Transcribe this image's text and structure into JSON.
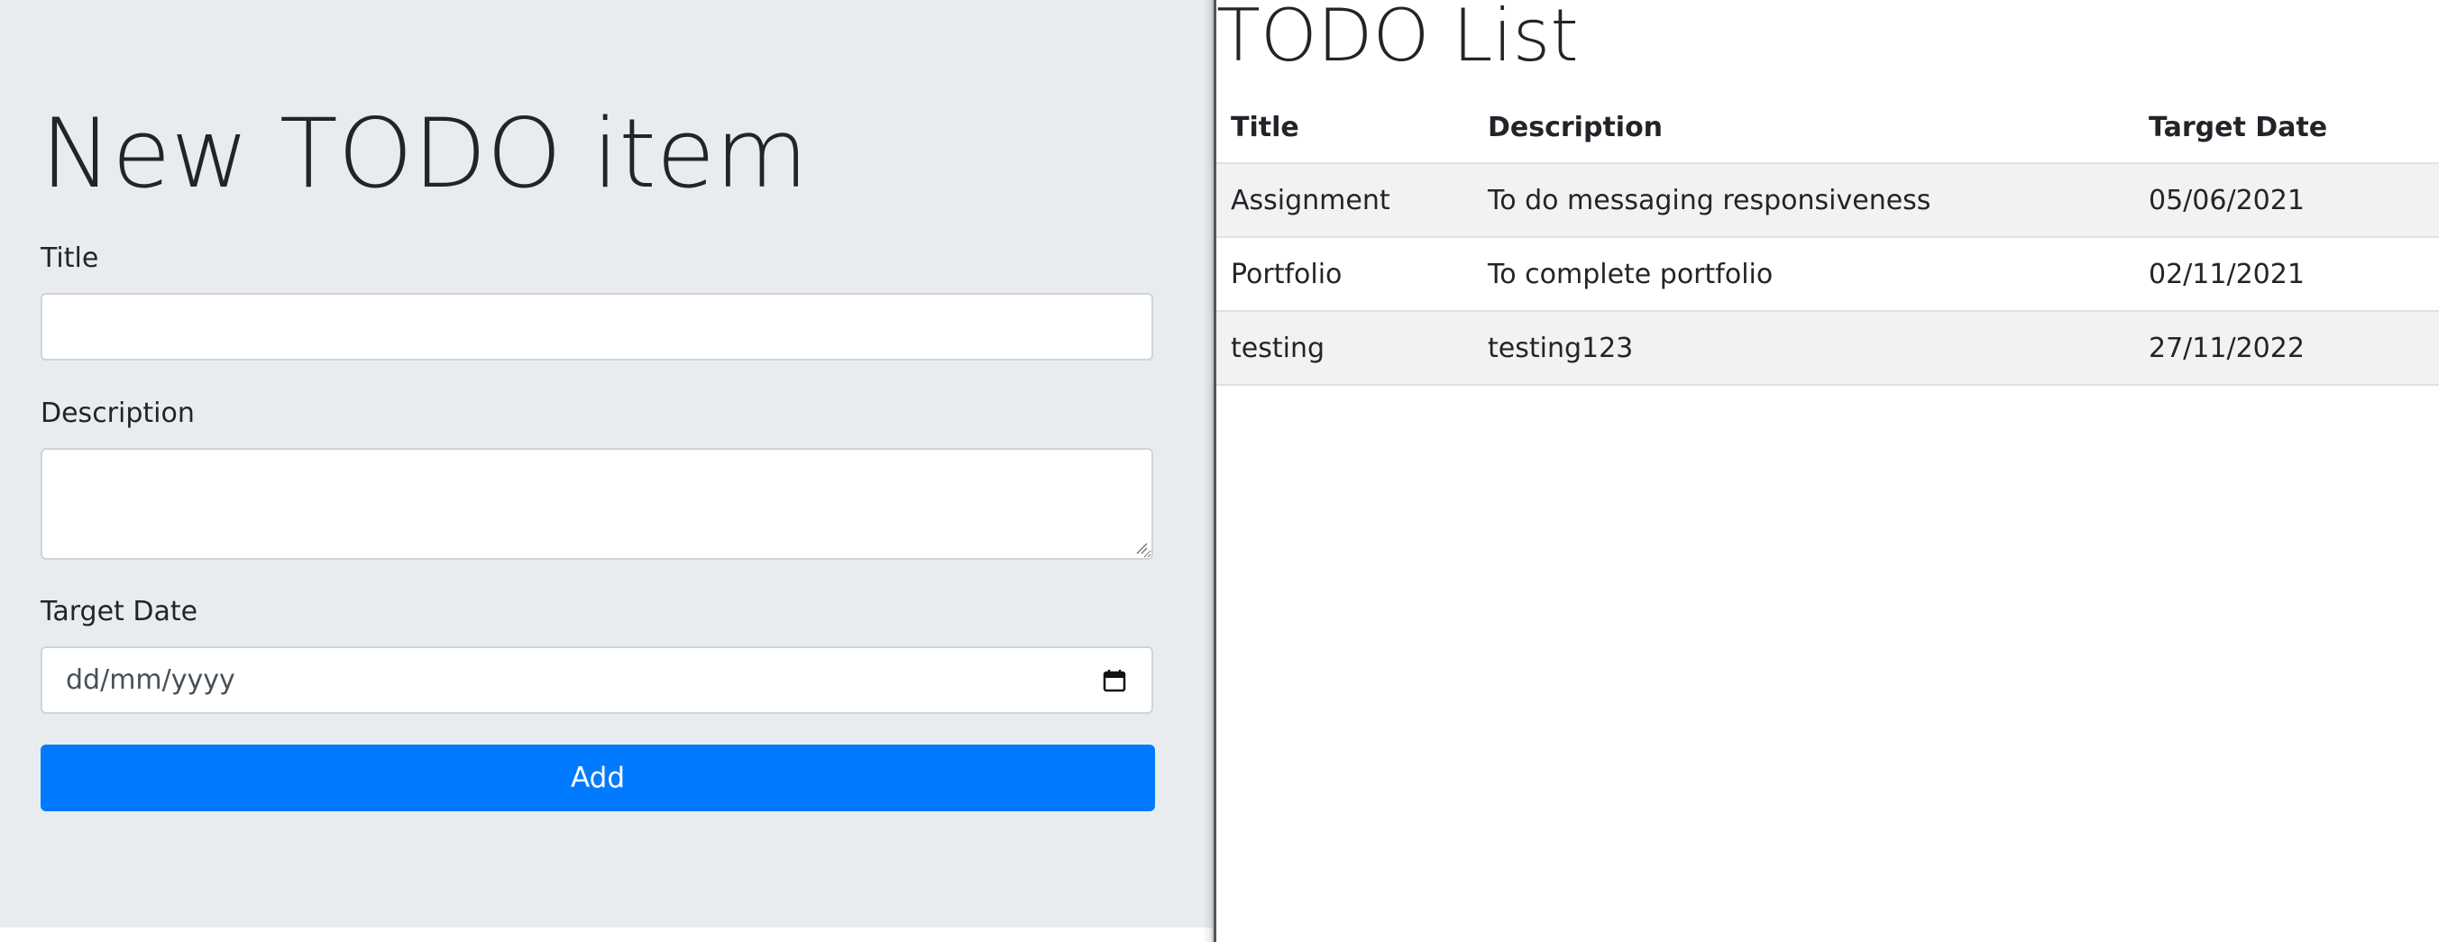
{
  "form": {
    "heading": "New TODO item",
    "title_label": "Title",
    "title_value": "",
    "description_label": "Description",
    "description_value": "",
    "target_date_label": "Target Date",
    "target_date_placeholder": "dd/mm/yyyy",
    "add_button_label": "Add",
    "calendar_icon": "calendar-icon"
  },
  "list": {
    "heading": "TODO List",
    "columns": [
      "Title",
      "Description",
      "Target Date"
    ],
    "rows": [
      {
        "title": "Assignment",
        "description": "To do messaging responsiveness",
        "target_date": "05/06/2021"
      },
      {
        "title": "Portfolio",
        "description": "To complete portfolio",
        "target_date": "02/11/2021"
      },
      {
        "title": "testing",
        "description": "testing123",
        "target_date": "27/11/2022"
      }
    ]
  },
  "colors": {
    "form_background": "#e9ecef",
    "primary_button": "#007bff",
    "striped_row": "#f2f2f2"
  }
}
